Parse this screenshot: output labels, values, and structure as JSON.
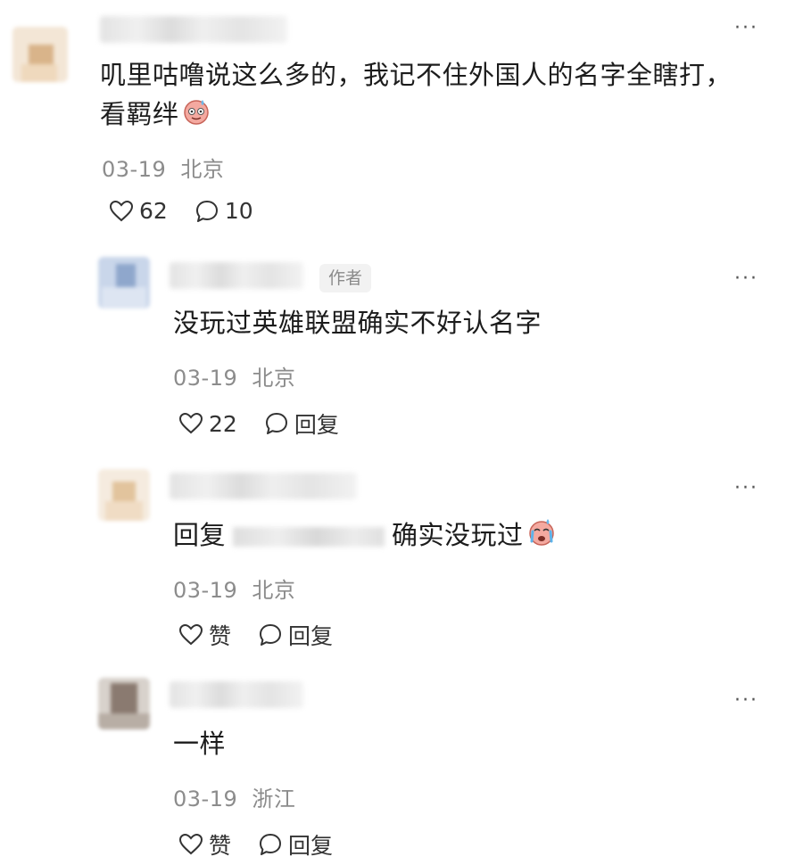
{
  "comments": [
    {
      "text_line1": "叽里咕噜说这么多的，我记不住外国人的名字全瞎打，",
      "text_line2": "看羁绊",
      "emoji": "sweat-smile-emoji",
      "date": "03-19",
      "location": "北京",
      "like_count": "62",
      "comment_count": "10"
    },
    {
      "author_badge": "作者",
      "text": "没玩过英雄联盟确实不好认名字",
      "date": "03-19",
      "location": "北京",
      "like_count": "22",
      "reply_label": "回复"
    },
    {
      "reply_prefix": "回复",
      "text": "确实没玩过",
      "emoji": "crying-emoji",
      "date": "03-19",
      "location": "北京",
      "like_label": "赞",
      "reply_label": "回复"
    },
    {
      "text": "一样",
      "date": "03-19",
      "location": "浙江",
      "like_label": "赞",
      "reply_label": "回复"
    }
  ],
  "more_label": "···"
}
